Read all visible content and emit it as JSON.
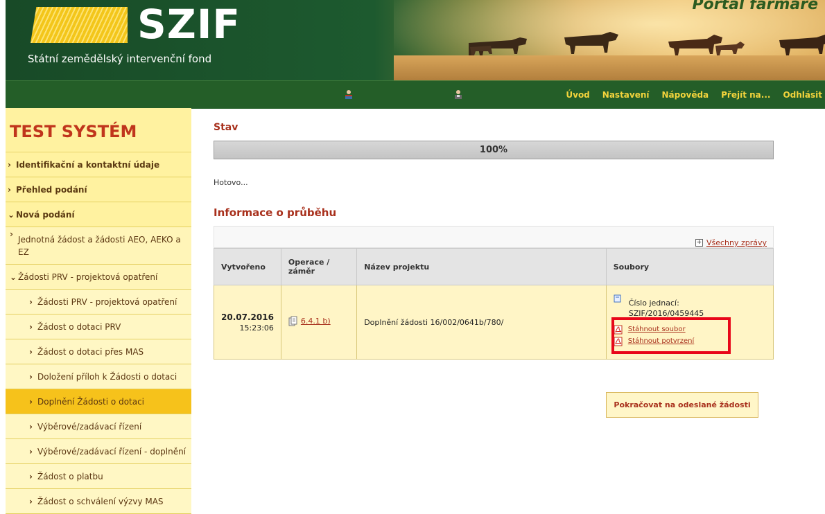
{
  "header": {
    "logo_text": "SZIF",
    "subtitle": "Státní zemědělský intervenční fond",
    "portal_title": "Portál farmáře"
  },
  "nav": {
    "items": [
      "Úvod",
      "Nastavení",
      "Nápověda",
      "Přejít na...",
      "Odhlásit"
    ]
  },
  "sidebar": {
    "title": "TEST SYSTÉM",
    "items": [
      {
        "label": "Identifikační a kontaktní údaje"
      },
      {
        "label": "Přehled podání"
      },
      {
        "label": "Nová podání"
      },
      {
        "label": "Jednotná žádost a žádosti AEO, AEKO a EZ"
      },
      {
        "label": "Žádosti PRV - projektová opatření"
      },
      {
        "label": "Žádosti PRV - projektová opatření"
      },
      {
        "label": "Žádost o dotaci PRV"
      },
      {
        "label": "Žádost o dotaci přes MAS"
      },
      {
        "label": "Doložení příloh k Žádosti o dotaci"
      },
      {
        "label": "Doplnění Žádosti o dotaci"
      },
      {
        "label": "Výběrové/zadávací řízení"
      },
      {
        "label": "Výběrové/zadávací řízení - doplnění"
      },
      {
        "label": "Žádost o platbu"
      },
      {
        "label": "Žádost o schválení výzvy MAS"
      }
    ]
  },
  "status": {
    "title": "Stav",
    "progress": 100,
    "progress_label": "100%",
    "done_text": "Hotovo..."
  },
  "progress_info": {
    "title": "Informace o průběhu",
    "all_messages": "Všechny zprávy"
  },
  "table": {
    "headers": [
      "Vytvořeno",
      "Operace / záměr",
      "Název projektu",
      "Soubory"
    ],
    "row": {
      "date": "20.07.2016",
      "time": "15:23:06",
      "operation": "6.4.1 b)",
      "project_name": "Doplnění žádosti 16/002/0641b/780/",
      "ref_label": "Číslo jednací:",
      "ref_value": "SZIF/2016/0459445",
      "download_file": "Stáhnout soubor",
      "download_confirmation": "Stáhnout potvrzení"
    }
  },
  "continue_button": "Pokračovat na odeslané žádosti",
  "colors": {
    "accent_red": "#a8301c",
    "nav_green": "#245e28",
    "nav_yellow": "#f4d43c",
    "sidebar_active": "#f6c21b",
    "highlight_box": "#e8071a"
  }
}
